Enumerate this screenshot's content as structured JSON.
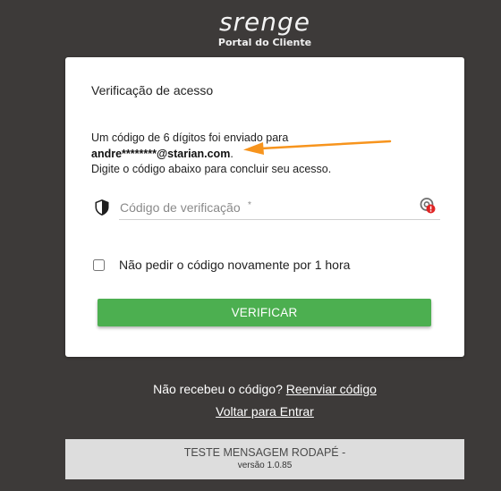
{
  "brand": {
    "logo_text": "srenge",
    "subtitle": "Portal do Cliente"
  },
  "card": {
    "title": "Verificação de acesso",
    "message_line1": "Um código de 6 dígitos foi enviado para",
    "masked_email": "andre********@starian.com",
    "email_suffix": ".",
    "message_line3": "Digite o código abaixo para concluir seu acesso.",
    "code_field": {
      "placeholder": "Código de verificação",
      "required_marker": "*",
      "value": ""
    },
    "remember": {
      "label": "Não pedir o código novamente por 1 hora",
      "checked": false
    },
    "verify_button": "VERIFICAR"
  },
  "links": {
    "resend_prompt": "Não recebeu o código?",
    "resend_link": "Reenviar código",
    "back_link": "Voltar para Entrar"
  },
  "footer": {
    "message": "TESTE MENSAGEM RODAPÉ -",
    "version": "versão 1.0.85"
  },
  "colors": {
    "background": "#3d3a39",
    "primary_button": "#4caf50",
    "annotation_arrow": "#f7941d",
    "alert_badge": "#e02424"
  },
  "icons": {
    "shield": "shield-icon",
    "password_manager": "password-manager-icon",
    "arrow": "annotation-arrow-icon"
  }
}
